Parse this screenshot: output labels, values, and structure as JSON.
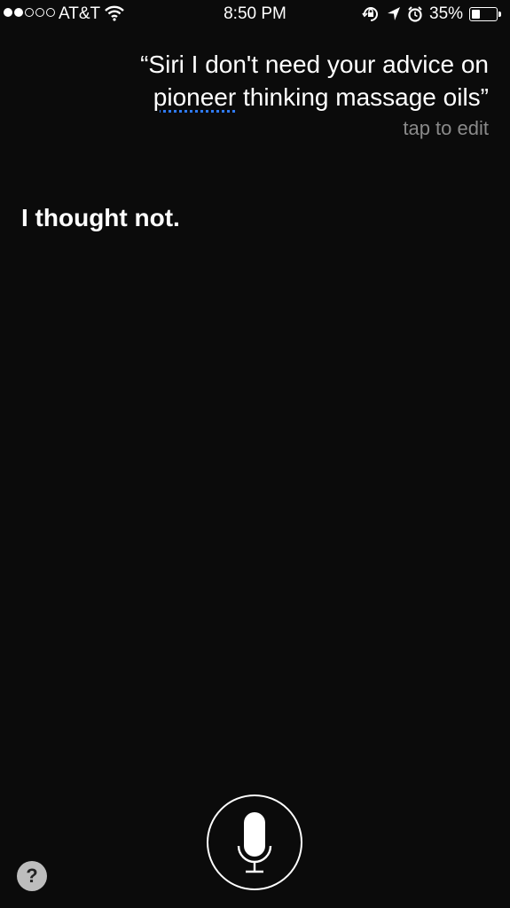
{
  "status_bar": {
    "signal_bars_filled": 2,
    "signal_bars_total": 5,
    "carrier": "AT&T",
    "time": "8:50 PM",
    "battery_percent_label": "35%",
    "battery_level": 0.35,
    "icons": [
      "wifi-icon",
      "rotation-lock-icon",
      "location-arrow-icon",
      "alarm-icon",
      "battery-icon"
    ]
  },
  "siri": {
    "query_open_quote": "“",
    "query_part1": "Siri I don't need your advice on",
    "query_underlined_word": "pioneer",
    "query_part2": " thinking massage oils",
    "query_close_quote": "”",
    "tap_to_edit": "tap to edit",
    "response": "I thought not."
  },
  "controls": {
    "mic_icon": "microphone-icon",
    "help_label": "?"
  },
  "colors": {
    "background": "#0b0b0b",
    "spellcheck_underline": "#2f7bf5",
    "secondary_text": "#8a8a8a"
  }
}
